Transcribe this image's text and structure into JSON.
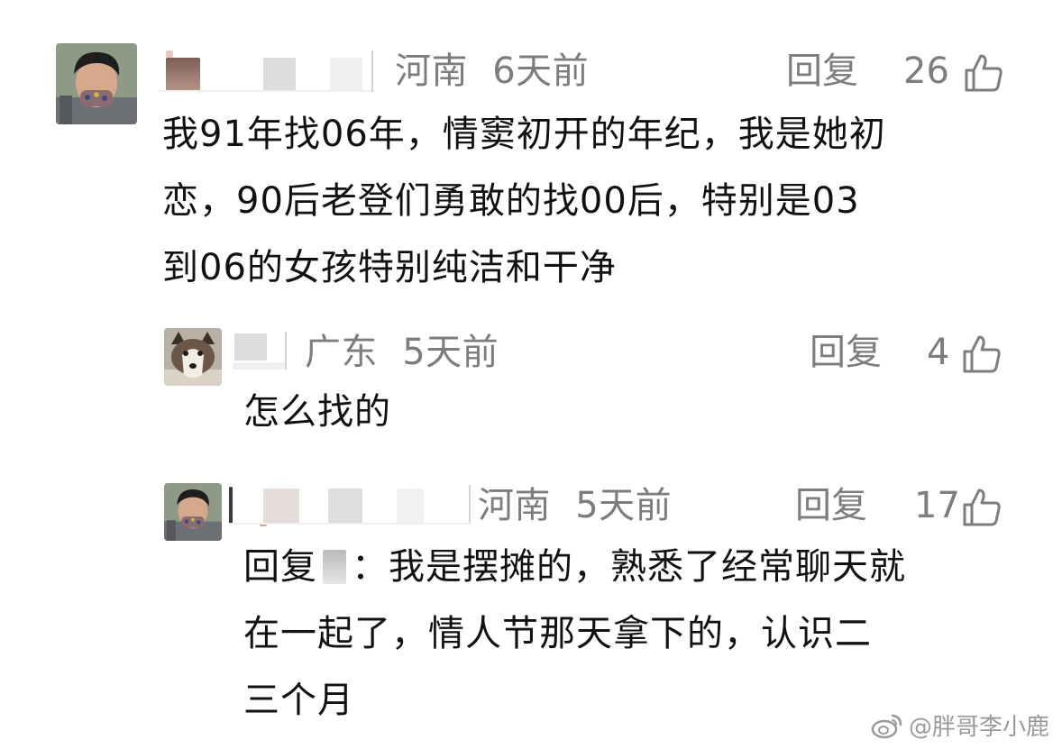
{
  "comments": [
    {
      "location": "河南",
      "time": "6天前",
      "reply_label": "回复",
      "likes": "26",
      "avatar": "man-with-mask",
      "lines": [
        "我91年找06年，情窦初开的年纪，我是她初",
        "恋，90后老登们勇敢的找00后，特别是03",
        "到06的女孩特别纯洁和干净"
      ]
    },
    {
      "location": "广东",
      "time": "5天前",
      "reply_label": "回复",
      "likes": "4",
      "avatar": "dog",
      "lines": [
        "怎么找的"
      ]
    },
    {
      "location": "河南",
      "time": "5天前",
      "reply_label": "回复",
      "likes": "17",
      "avatar": "man-with-mask",
      "reply_prefix": "回复",
      "lines": [
        "：我是摆摊的，熟悉了经常聊天就",
        "在一起了，情人节那天拿下的，认识二",
        "三个月"
      ]
    }
  ],
  "watermark": {
    "icon": "weibo-icon",
    "text": "@胖哥李小鹿"
  },
  "colors": {
    "meta_gray": "#7d7d7d",
    "text": "#111111"
  }
}
